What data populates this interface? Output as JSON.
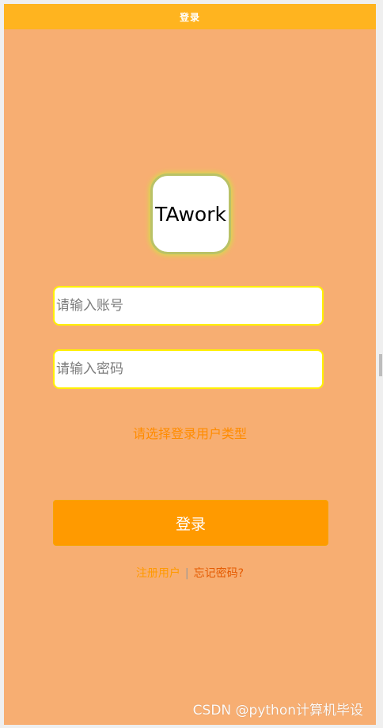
{
  "titlebar": {
    "title": "登录"
  },
  "logo": {
    "text": "TAwork"
  },
  "form": {
    "username_placeholder": "请输入账号",
    "password_placeholder": "请输入密码",
    "usertype_prompt": "请选择登录用户类型",
    "login_label": "登录"
  },
  "links": {
    "register": "注册用户",
    "separator": "|",
    "forgot": "忘记密码?"
  },
  "watermark": {
    "text": "CSDN @python计算机毕设"
  },
  "colors": {
    "page_bg": "#f7ae72",
    "titlebar_bg": "#ffb41f",
    "button_bg": "#ff9a00",
    "input_border": "#fff000",
    "usertype_text": "#ff8c00",
    "forgot_text": "#e55a00"
  }
}
